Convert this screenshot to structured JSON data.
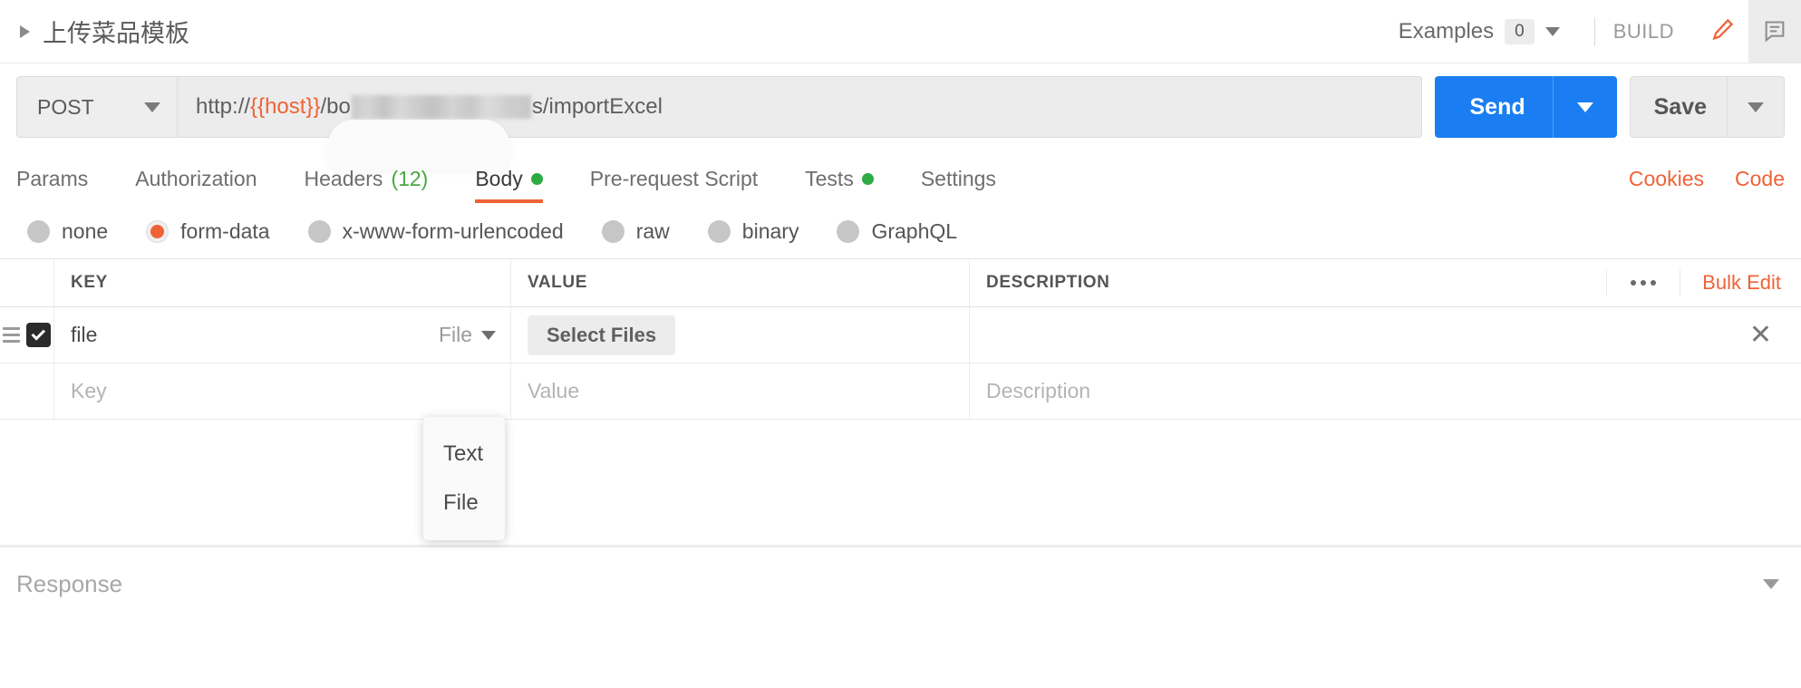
{
  "header": {
    "request_title": "上传菜品模板",
    "collapse_icon": "caret-right-icon",
    "examples_label": "Examples",
    "examples_count": "0",
    "examples_caret": "chevron-down-icon",
    "build_label": "BUILD",
    "edit_tab_icon": "pencil-icon",
    "comment_tab_icon": "comment-icon"
  },
  "urlbar": {
    "method": "POST",
    "method_caret": "chevron-down-icon",
    "url_scheme": "http://",
    "url_variable": "{{host}}",
    "url_path_prefix": "/bo",
    "url_path_suffix": "s/importExcel",
    "send_label": "Send",
    "send_caret": "chevron-down-icon",
    "save_label": "Save",
    "save_caret": "chevron-down-icon"
  },
  "tabs": {
    "items": [
      {
        "label": "Params",
        "badge": "",
        "dot": false,
        "active": false
      },
      {
        "label": "Authorization",
        "badge": "",
        "dot": false,
        "active": false
      },
      {
        "label": "Headers",
        "badge": "(12)",
        "dot": false,
        "active": false
      },
      {
        "label": "Body",
        "badge": "",
        "dot": true,
        "active": true
      },
      {
        "label": "Pre-request Script",
        "badge": "",
        "dot": false,
        "active": false
      },
      {
        "label": "Tests",
        "badge": "",
        "dot": true,
        "active": false
      },
      {
        "label": "Settings",
        "badge": "",
        "dot": false,
        "active": false
      }
    ],
    "cookies_link": "Cookies",
    "code_link": "Code"
  },
  "body_types": {
    "options": [
      {
        "label": "none",
        "selected": false
      },
      {
        "label": "form-data",
        "selected": true
      },
      {
        "label": "x-www-form-urlencoded",
        "selected": false
      },
      {
        "label": "raw",
        "selected": false
      },
      {
        "label": "binary",
        "selected": false
      },
      {
        "label": "GraphQL",
        "selected": false
      }
    ]
  },
  "table": {
    "columns": {
      "key": "KEY",
      "value": "VALUE",
      "description": "DESCRIPTION"
    },
    "options_icon": "ellipsis-icon",
    "bulk_edit": "Bulk Edit",
    "rows": [
      {
        "checked": true,
        "key": "file",
        "type": "File",
        "value_button": "Select Files",
        "description": "",
        "close_icon": "close-icon"
      }
    ],
    "new_row": {
      "key_placeholder": "Key",
      "value_placeholder": "Value",
      "description_placeholder": "Description"
    }
  },
  "type_dropdown": {
    "open": true,
    "items": [
      "Text",
      "File"
    ]
  },
  "response": {
    "label": "Response",
    "caret": "chevron-down-icon"
  },
  "colors": {
    "accent_orange": "#ef6237",
    "send_blue": "#1a7ef2",
    "status_green": "#2eab43"
  }
}
